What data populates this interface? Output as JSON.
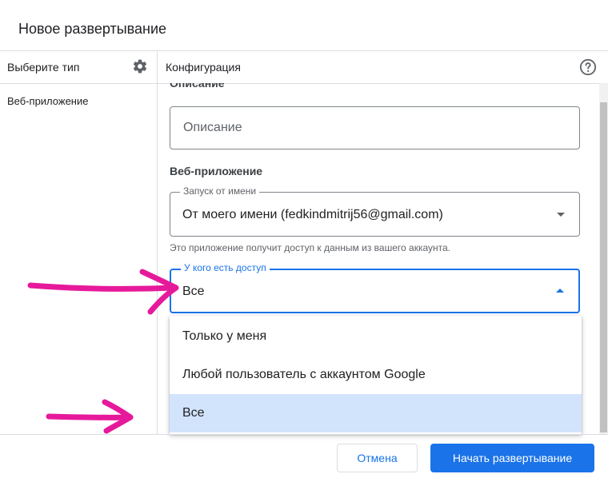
{
  "dialog": {
    "title": "Новое развертывание"
  },
  "left_panel": {
    "header": "Выберите тип",
    "items": [
      {
        "label": "Веб-приложение"
      }
    ]
  },
  "right_panel": {
    "header": "Конфигурация",
    "description_section_label": "Описание",
    "description_placeholder": "Описание",
    "web_app_section_label": "Веб-приложение",
    "run_as": {
      "label": "Запуск от имени",
      "value": "От моего имени (fedkindmitrij56@gmail.com)",
      "hint": "Это приложение получит доступ к данным из вашего аккаунта."
    },
    "access": {
      "label": "У кого есть доступ",
      "value": "Все",
      "options": [
        {
          "label": "Только у меня"
        },
        {
          "label": "Любой пользователь с аккаунтом Google"
        },
        {
          "label": "Все"
        }
      ]
    }
  },
  "footer": {
    "cancel_label": "Отмена",
    "deploy_label": "Начать развертывание"
  },
  "colors": {
    "accent": "#1a73e8",
    "selected_option_bg": "#d2e3fc",
    "annotation_arrow": "#e6199b"
  }
}
